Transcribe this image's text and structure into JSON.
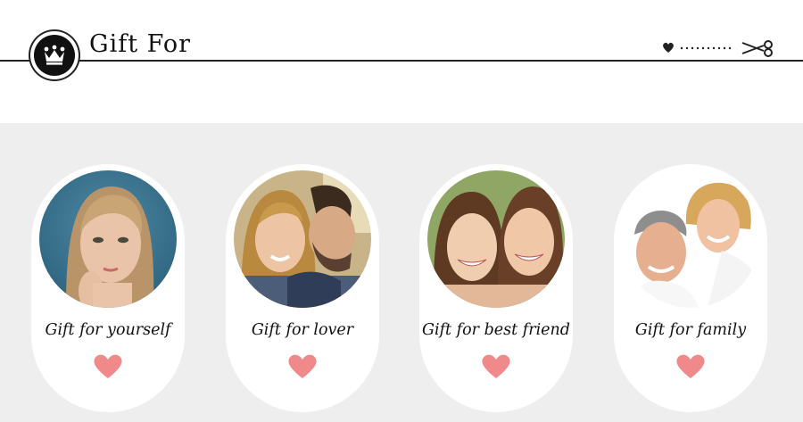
{
  "header": {
    "title": "Gift For",
    "crown_icon": "crown-icon",
    "decoration_icons": [
      "heart-icon",
      "scissors-icon"
    ]
  },
  "colors": {
    "background_band": "#eeeeee",
    "heart": "#f08a8a",
    "line": "#222222"
  },
  "cards": [
    {
      "label": "Gift for yourself",
      "photo": "young-woman-portrait",
      "icon": "heart-icon"
    },
    {
      "label": "Gift for lover",
      "photo": "smiling-couple",
      "icon": "heart-icon"
    },
    {
      "label": "Gift for best friend",
      "photo": "two-laughing-women",
      "icon": "heart-icon"
    },
    {
      "label": "Gift for family",
      "photo": "smiling-older-couple",
      "icon": "heart-icon"
    }
  ]
}
